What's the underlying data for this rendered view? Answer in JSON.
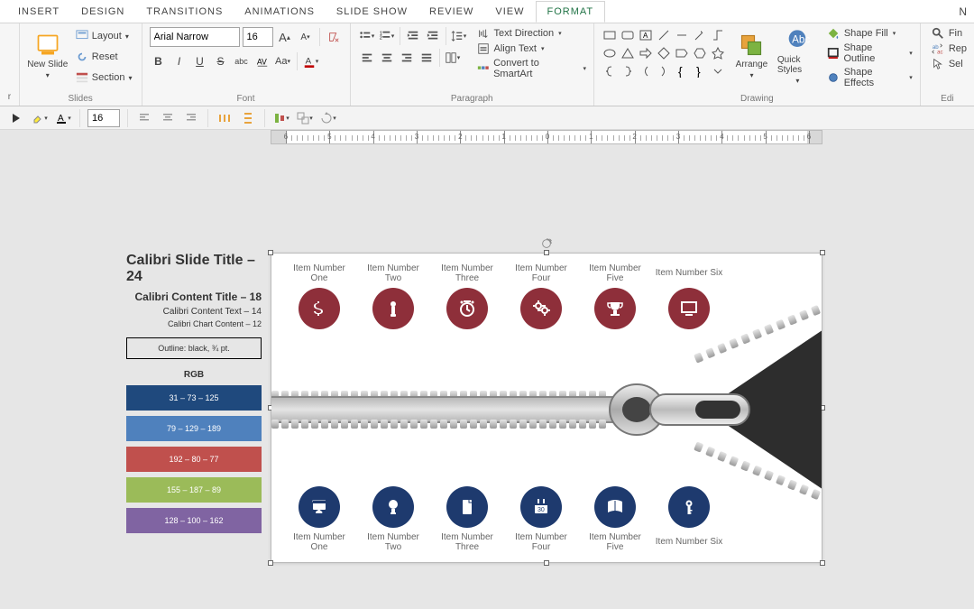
{
  "tabs": [
    "INSERT",
    "DESIGN",
    "TRANSITIONS",
    "ANIMATIONS",
    "SLIDE SHOW",
    "REVIEW",
    "VIEW",
    "FORMAT"
  ],
  "active_tab": "FORMAT",
  "right_label": "N",
  "slides_group": {
    "new_slide": "New Slide",
    "layout": "Layout",
    "reset": "Reset",
    "section": "Section",
    "label": "Slides"
  },
  "font_group": {
    "name": "Arial Narrow",
    "size": "16",
    "label": "Font"
  },
  "paragraph_group": {
    "text_direction": "Text Direction",
    "align_text": "Align Text",
    "convert": "Convert to SmartArt",
    "label": "Paragraph"
  },
  "drawing_group": {
    "arrange": "Arrange",
    "quick_styles": "Quick Styles",
    "shape_fill": "Shape Fill",
    "shape_outline": "Shape Outline",
    "shape_effects": "Shape Effects",
    "label": "Drawing"
  },
  "edit_group": {
    "find": "Fin",
    "replace": "Rep",
    "select": "Sel",
    "label": "Edi"
  },
  "cut_label": "r",
  "qat": {
    "size": "16"
  },
  "ruler_numbers": [
    "6",
    "5",
    "4",
    "3",
    "2",
    "1",
    "0",
    "1",
    "2",
    "3",
    "4",
    "5",
    "6"
  ],
  "notes": {
    "title": "Calibri  Slide Title – 24",
    "content_title": "Calibri Content Title – 18",
    "content_text": "Calibri  Content  Text – 14",
    "chart_content": "Calibri Chart  Content – 12",
    "outline": "Outline: black, ¾ pt.",
    "rgb_label": "RGB"
  },
  "swatches": [
    {
      "text": "31 – 73 – 125",
      "color": "#1f497d"
    },
    {
      "text": "79 – 129 – 189",
      "color": "#4f81bd"
    },
    {
      "text": "192 – 80 – 77",
      "color": "#c0504d"
    },
    {
      "text": "155 – 187 – 89",
      "color": "#9bbb59"
    },
    {
      "text": "128 – 100 – 162",
      "color": "#8064a2"
    }
  ],
  "items_top": [
    "Item Number One",
    "Item Number Two",
    "Item Number Three",
    "Item Number Four",
    "Item Number Five",
    "Item Number Six"
  ],
  "items_bot": [
    "Item Number One",
    "Item Number Two",
    "Item Number Three",
    "Item Number Four",
    "Item Number Five",
    "Item Number Six"
  ],
  "calendar_day": "30"
}
